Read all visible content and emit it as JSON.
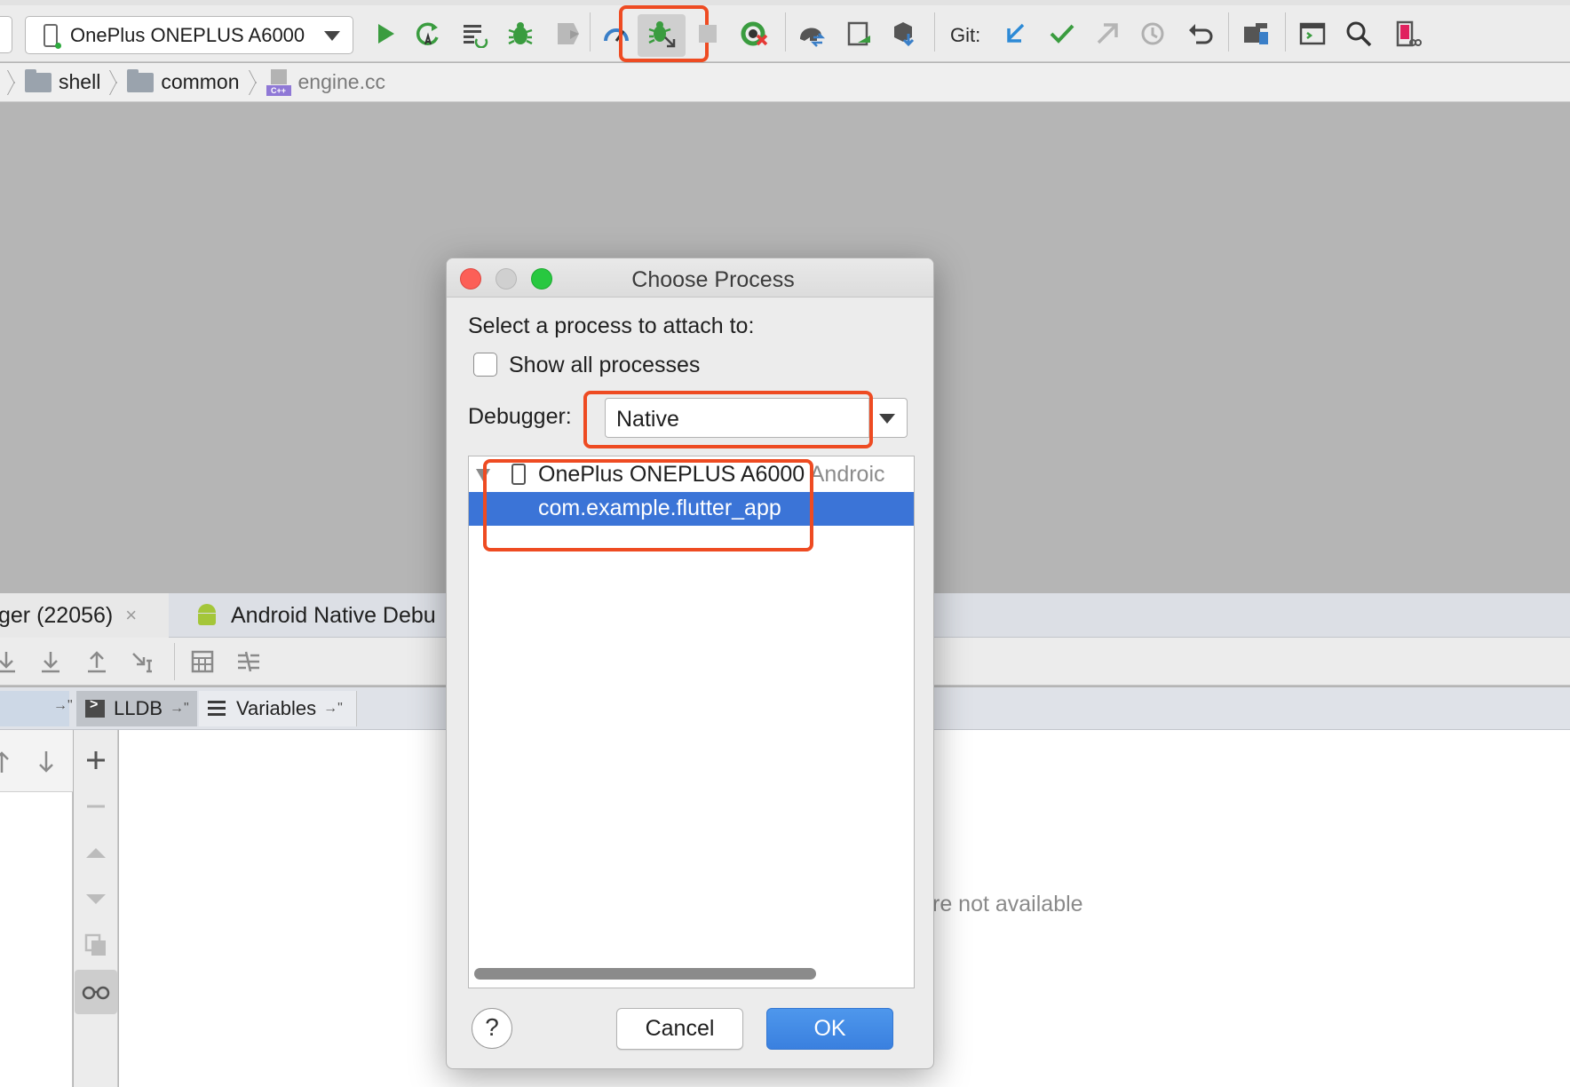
{
  "toolbar": {
    "device_selector_label": "OnePlus ONEPLUS A6000",
    "git_label": "Git:",
    "icons": [
      "run-icon",
      "apply-changes-icon",
      "apply-code-changes-icon",
      "debug-icon",
      "profile-icon",
      "attach-debugger-icon",
      "stop-icon",
      "coverage-icon",
      "gradle-sync-icon",
      "avd-manager-icon",
      "sdk-manager-icon",
      "git-update-icon",
      "git-commit-icon",
      "git-push-icon",
      "git-history-icon",
      "git-rollback-icon",
      "project-structure-icon",
      "terminal-icon",
      "search-icon",
      "device-manager-icon"
    ]
  },
  "breadcrumb": {
    "items": [
      "shell",
      "common",
      "engine.cc"
    ],
    "file_badge": "C++"
  },
  "debug_panel": {
    "tab_debugger_label": "ger (22056)",
    "tab_debugger_close": "×",
    "tab_native_label": "Android Native Debu",
    "sub_tab_lldb": "LLDB",
    "sub_tab_variables": "Variables",
    "pin_glyph": "→\"",
    "variables_message": "re not available"
  },
  "dialog": {
    "title": "Choose Process",
    "prompt": "Select a process to attach to:",
    "show_all_label": "Show all processes",
    "show_all_checked": false,
    "debugger_label": "Debugger:",
    "debugger_value": "Native",
    "tree": {
      "device_name": "OnePlus ONEPLUS A6000",
      "device_suffix": "Androic",
      "process_name": "com.example.flutter_app"
    },
    "help_label": "?",
    "cancel_label": "Cancel",
    "ok_label": "OK"
  },
  "colors": {
    "highlight": "#ee4b22",
    "selection": "#3b74d7",
    "ok_button": "#3a80df"
  }
}
